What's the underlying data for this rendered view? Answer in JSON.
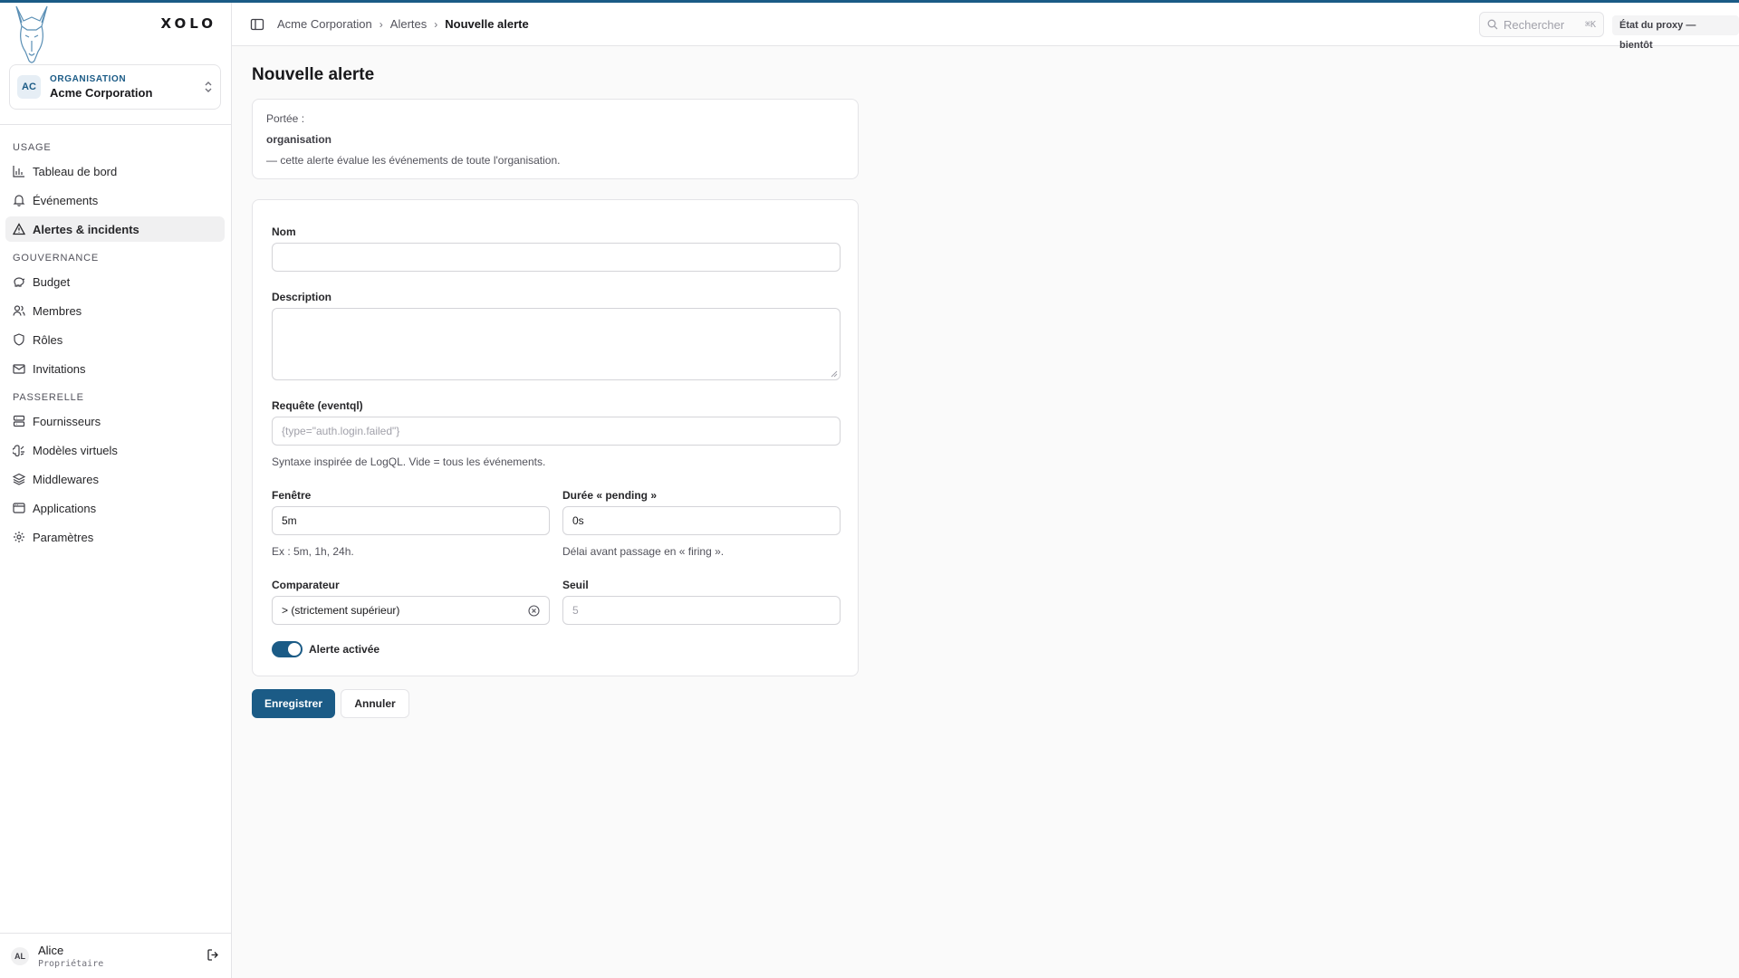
{
  "brand": {
    "name": "XOLO"
  },
  "org": {
    "eyebrow": "ORGANISATION",
    "name": "Acme Corporation",
    "initials": "AC"
  },
  "nav": {
    "sections": [
      {
        "title": "USAGE",
        "items": [
          "Tableau de bord",
          "Événements",
          "Alertes & incidents"
        ]
      },
      {
        "title": "GOUVERNANCE",
        "items": [
          "Budget",
          "Membres",
          "Rôles",
          "Invitations"
        ]
      },
      {
        "title": "PASSERELLE",
        "items": [
          "Fournisseurs",
          "Modèles virtuels",
          "Middlewares",
          "Applications",
          "Paramètres"
        ]
      }
    ],
    "active": "Alertes & incidents"
  },
  "user": {
    "initials": "AL",
    "name": "Alice",
    "role": "Propriétaire"
  },
  "header": {
    "breadcrumb": [
      "Acme Corporation",
      "Alertes",
      "Nouvelle alerte"
    ],
    "search_placeholder": "Rechercher",
    "search_shortcut": "⌘K",
    "proxy_status": "État du proxy — bientôt"
  },
  "page": {
    "title": "Nouvelle alerte",
    "scope": {
      "label": "Portée :",
      "value": "organisation",
      "note": "— cette alerte évalue les événements de toute l'organisation."
    },
    "form": {
      "name_label": "Nom",
      "name_value": "",
      "description_label": "Description",
      "description_value": "",
      "query_label": "Requête (eventql)",
      "query_placeholder": "{type=\"auth.login.failed\"}",
      "query_help": "Syntaxe inspirée de LogQL. Vide = tous les événements.",
      "window_label": "Fenêtre",
      "window_value": "5m",
      "window_help": "Ex : 5m, 1h, 24h.",
      "pending_label": "Durée « pending »",
      "pending_value": "0s",
      "pending_help": "Délai avant passage en « firing ».",
      "comparator_label": "Comparateur",
      "comparator_value": "> (strictement supérieur)",
      "threshold_label": "Seuil",
      "threshold_placeholder": "5",
      "enabled_label": "Alerte activée",
      "enabled": true
    },
    "actions": {
      "save": "Enregistrer",
      "cancel": "Annuler"
    }
  },
  "colors": {
    "accent": "#1b5b86",
    "border": "#e4e4e7",
    "background": "#fafafa"
  }
}
